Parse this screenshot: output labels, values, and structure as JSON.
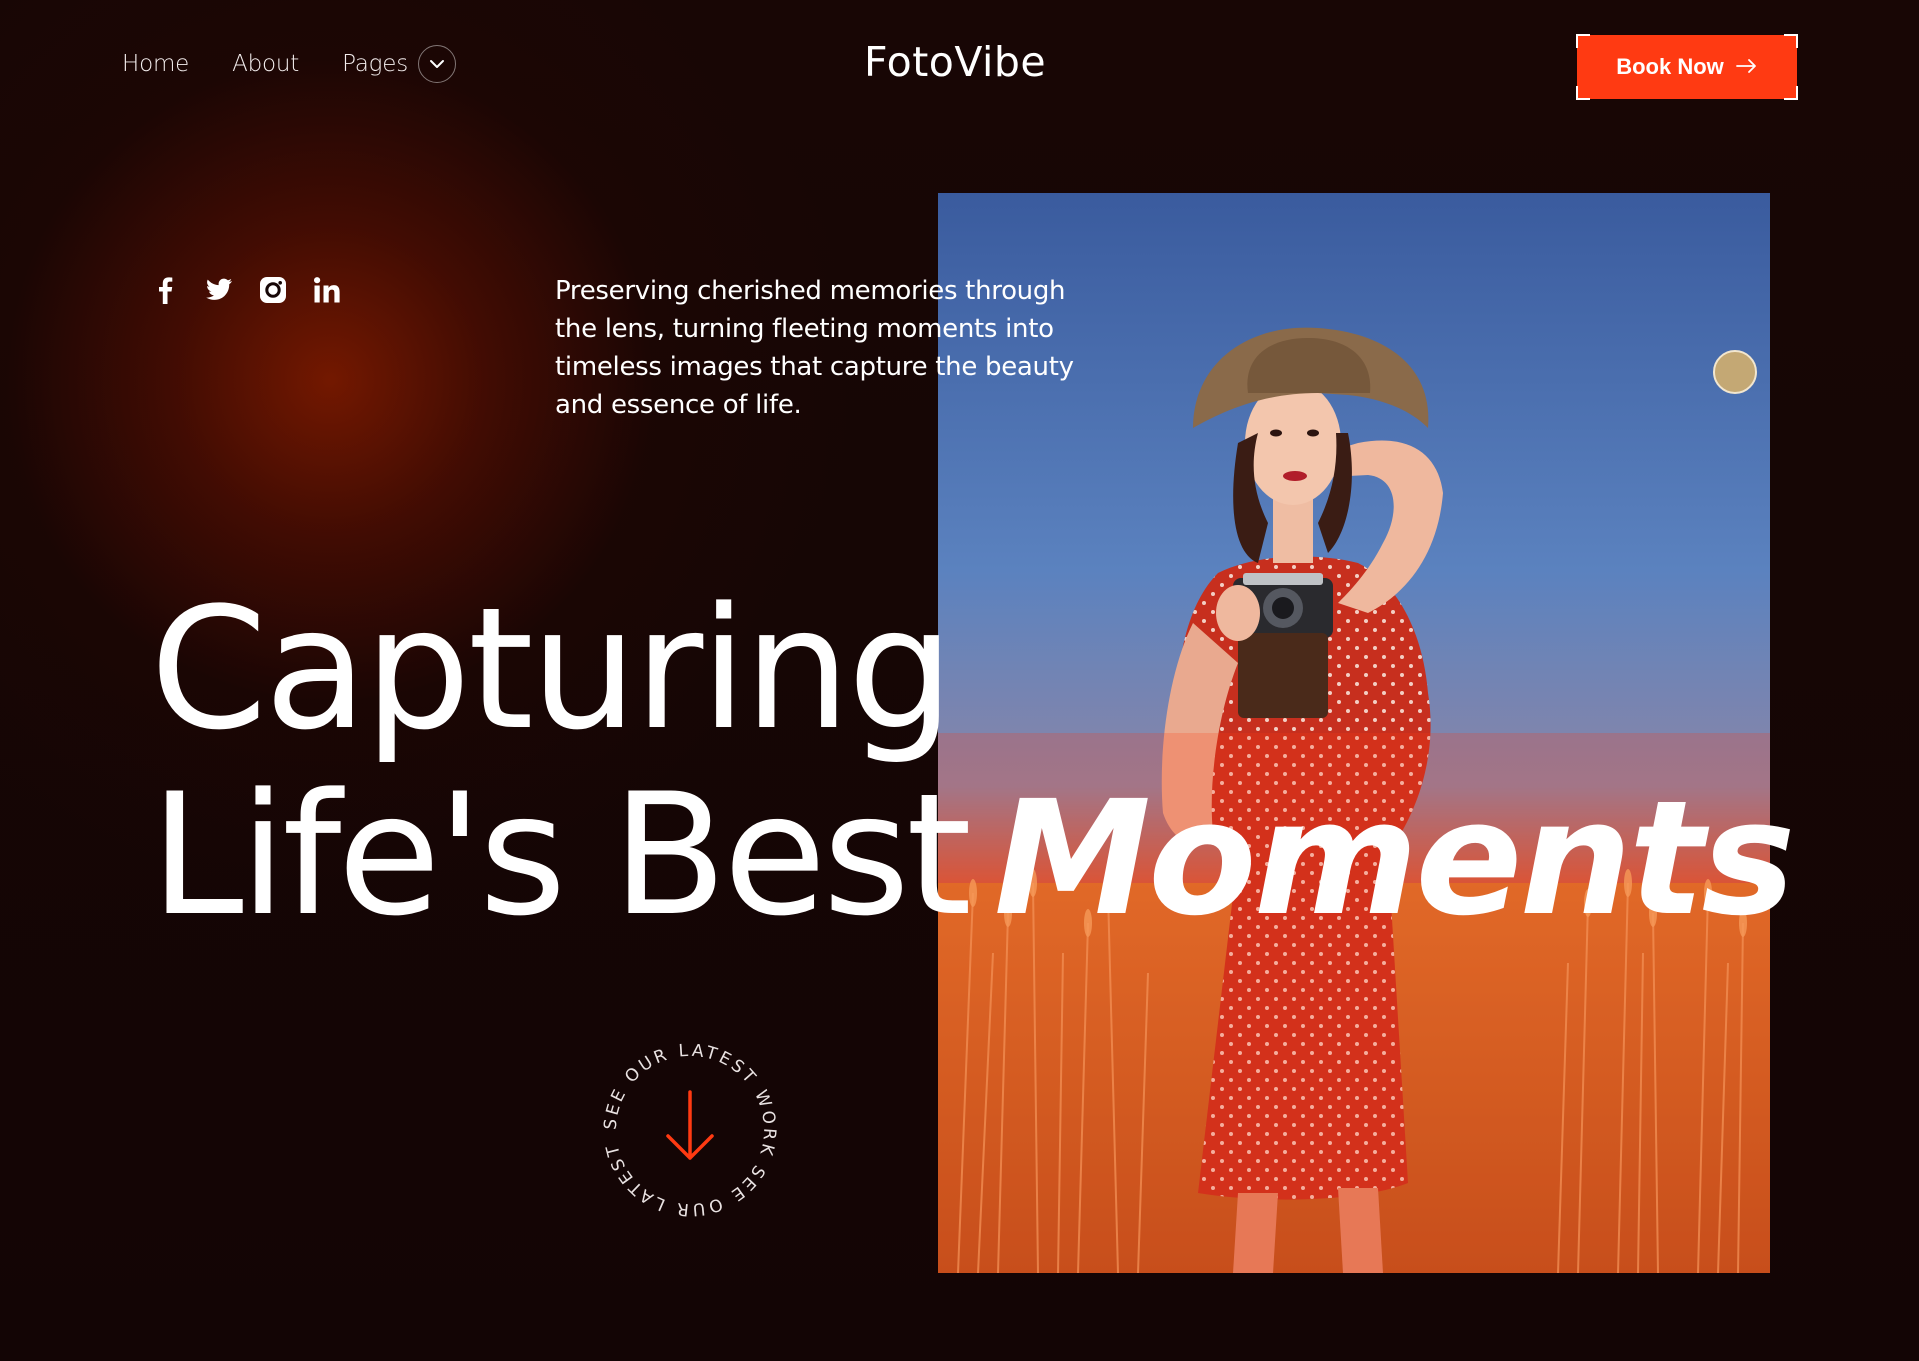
{
  "nav": {
    "links": [
      {
        "label": "Home"
      },
      {
        "label": "About"
      },
      {
        "label": "Pages"
      }
    ],
    "brand": "FotoVibe",
    "cta_label": "Book Now"
  },
  "social": {
    "icons": [
      "facebook-icon",
      "twitter-icon",
      "instagram-icon",
      "linkedin-icon"
    ]
  },
  "intro": {
    "text": "Preserving cherished memories through the lens, turning fleeting moments into timeless images that capture the beauty and essence of life."
  },
  "hero": {
    "line1": "Capturing",
    "line2_light": "Life's Best",
    "line2_bold": "Moments"
  },
  "badge": {
    "text": "SEE OUR LATEST WORK  SEE OUR LATEST WORK  "
  },
  "colors": {
    "accent": "#ff3a12",
    "background": "#150606",
    "glow": "#7a1900",
    "dot": "#c4a874"
  }
}
